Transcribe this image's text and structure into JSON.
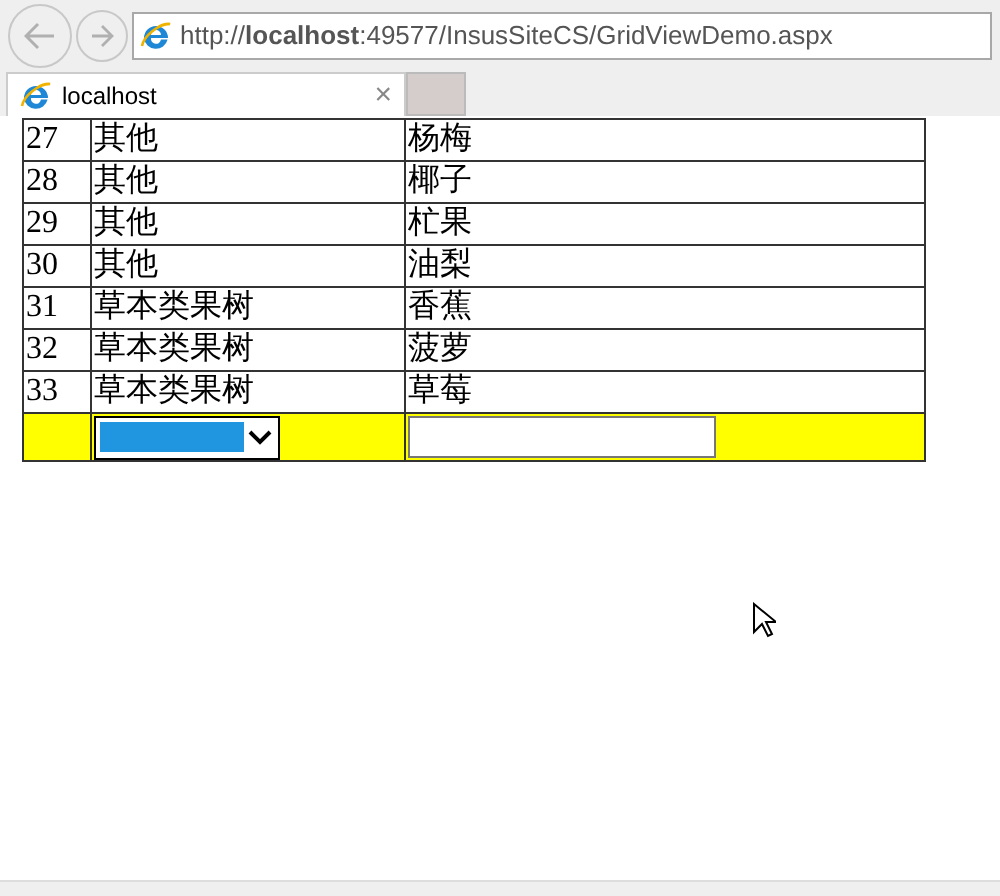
{
  "address_bar": {
    "url": "http://**localhost**:49577/InsusSiteCS/GridViewDemo.aspx"
  },
  "tabs": [
    {
      "label": "localhost",
      "selected": true,
      "close": "×"
    }
  ],
  "table": {
    "rows": [
      {
        "id": "27",
        "category": "其他",
        "name": "杨梅"
      },
      {
        "id": "28",
        "category": "其他",
        "name": "椰子"
      },
      {
        "id": "29",
        "category": "其他",
        "name": "杧果"
      },
      {
        "id": "30",
        "category": "其他",
        "name": "油梨"
      },
      {
        "id": "31",
        "category": "草本类果树",
        "name": "香蕉"
      },
      {
        "id": "32",
        "category": "草本类果树",
        "name": "菠萝"
      },
      {
        "id": "33",
        "category": "草本类果树",
        "name": "草莓"
      }
    ]
  }
}
